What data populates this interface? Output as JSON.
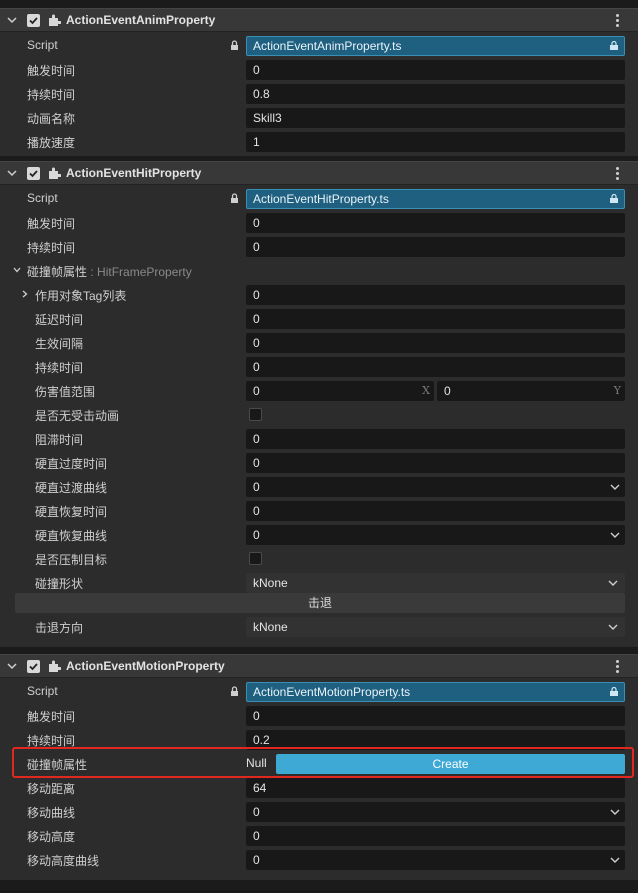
{
  "colors": {
    "accent": "#3fa9d6",
    "asset": "#1f5f7f",
    "highlight": "#e0281e"
  },
  "anim": {
    "title": "ActionEventAnimProperty",
    "script_label": "Script",
    "script_value": "ActionEventAnimProperty.ts",
    "fields": [
      {
        "label": "触发时间",
        "value": "0"
      },
      {
        "label": "持续时间",
        "value": "0.8"
      },
      {
        "label": "动画名称",
        "value": "Skill3"
      },
      {
        "label": "播放速度",
        "value": "1"
      }
    ]
  },
  "hit": {
    "title": "ActionEventHitProperty",
    "script_label": "Script",
    "script_value": "ActionEventHitProperty.ts",
    "trigger": {
      "label": "触发时间",
      "value": "0"
    },
    "duration": {
      "label": "持续时间",
      "value": "0"
    },
    "frame_group": {
      "label": "碰撞帧属性",
      "type": "HitFrameProperty"
    },
    "tag_list": {
      "label": "作用对象Tag列表",
      "value": "0"
    },
    "delay": {
      "label": "延迟时间",
      "value": "0"
    },
    "interval": {
      "label": "生效间隔",
      "value": "0"
    },
    "lasting": {
      "label": "持续时间",
      "value": "0"
    },
    "damage_range": {
      "label": "伤害值范围",
      "x": "0",
      "x_axis": "X",
      "y": "0",
      "y_axis": "Y"
    },
    "no_hit_anim": {
      "label": "是否无受击动画",
      "checked": false
    },
    "stall": {
      "label": "阻滞时间",
      "value": "0"
    },
    "stiff_transition": {
      "label": "硬直过度时间",
      "value": "0"
    },
    "stiff_curve": {
      "label": "硬直过渡曲线",
      "value": "0"
    },
    "stiff_recover": {
      "label": "硬直恢复时间",
      "value": "0"
    },
    "recover_curve": {
      "label": "硬直恢复曲线",
      "value": "0"
    },
    "suppress": {
      "label": "是否压制目标",
      "checked": false
    },
    "shape": {
      "label": "碰撞形状",
      "value": "kNone"
    },
    "knockback_button": "击退",
    "knockback_dir": {
      "label": "击退方向",
      "value": "kNone"
    }
  },
  "motion": {
    "title": "ActionEventMotionProperty",
    "script_label": "Script",
    "script_value": "ActionEventMotionProperty.ts",
    "trigger": {
      "label": "触发时间",
      "value": "0"
    },
    "duration": {
      "label": "持续时间",
      "value": "0.2"
    },
    "frame": {
      "label": "碰撞帧属性",
      "null_text": "Null",
      "create_label": "Create"
    },
    "distance": {
      "label": "移动距离",
      "value": "64"
    },
    "curve": {
      "label": "移动曲线",
      "value": "0"
    },
    "height": {
      "label": "移动高度",
      "value": "0"
    },
    "height_curve": {
      "label": "移动高度曲线",
      "value": "0"
    }
  }
}
